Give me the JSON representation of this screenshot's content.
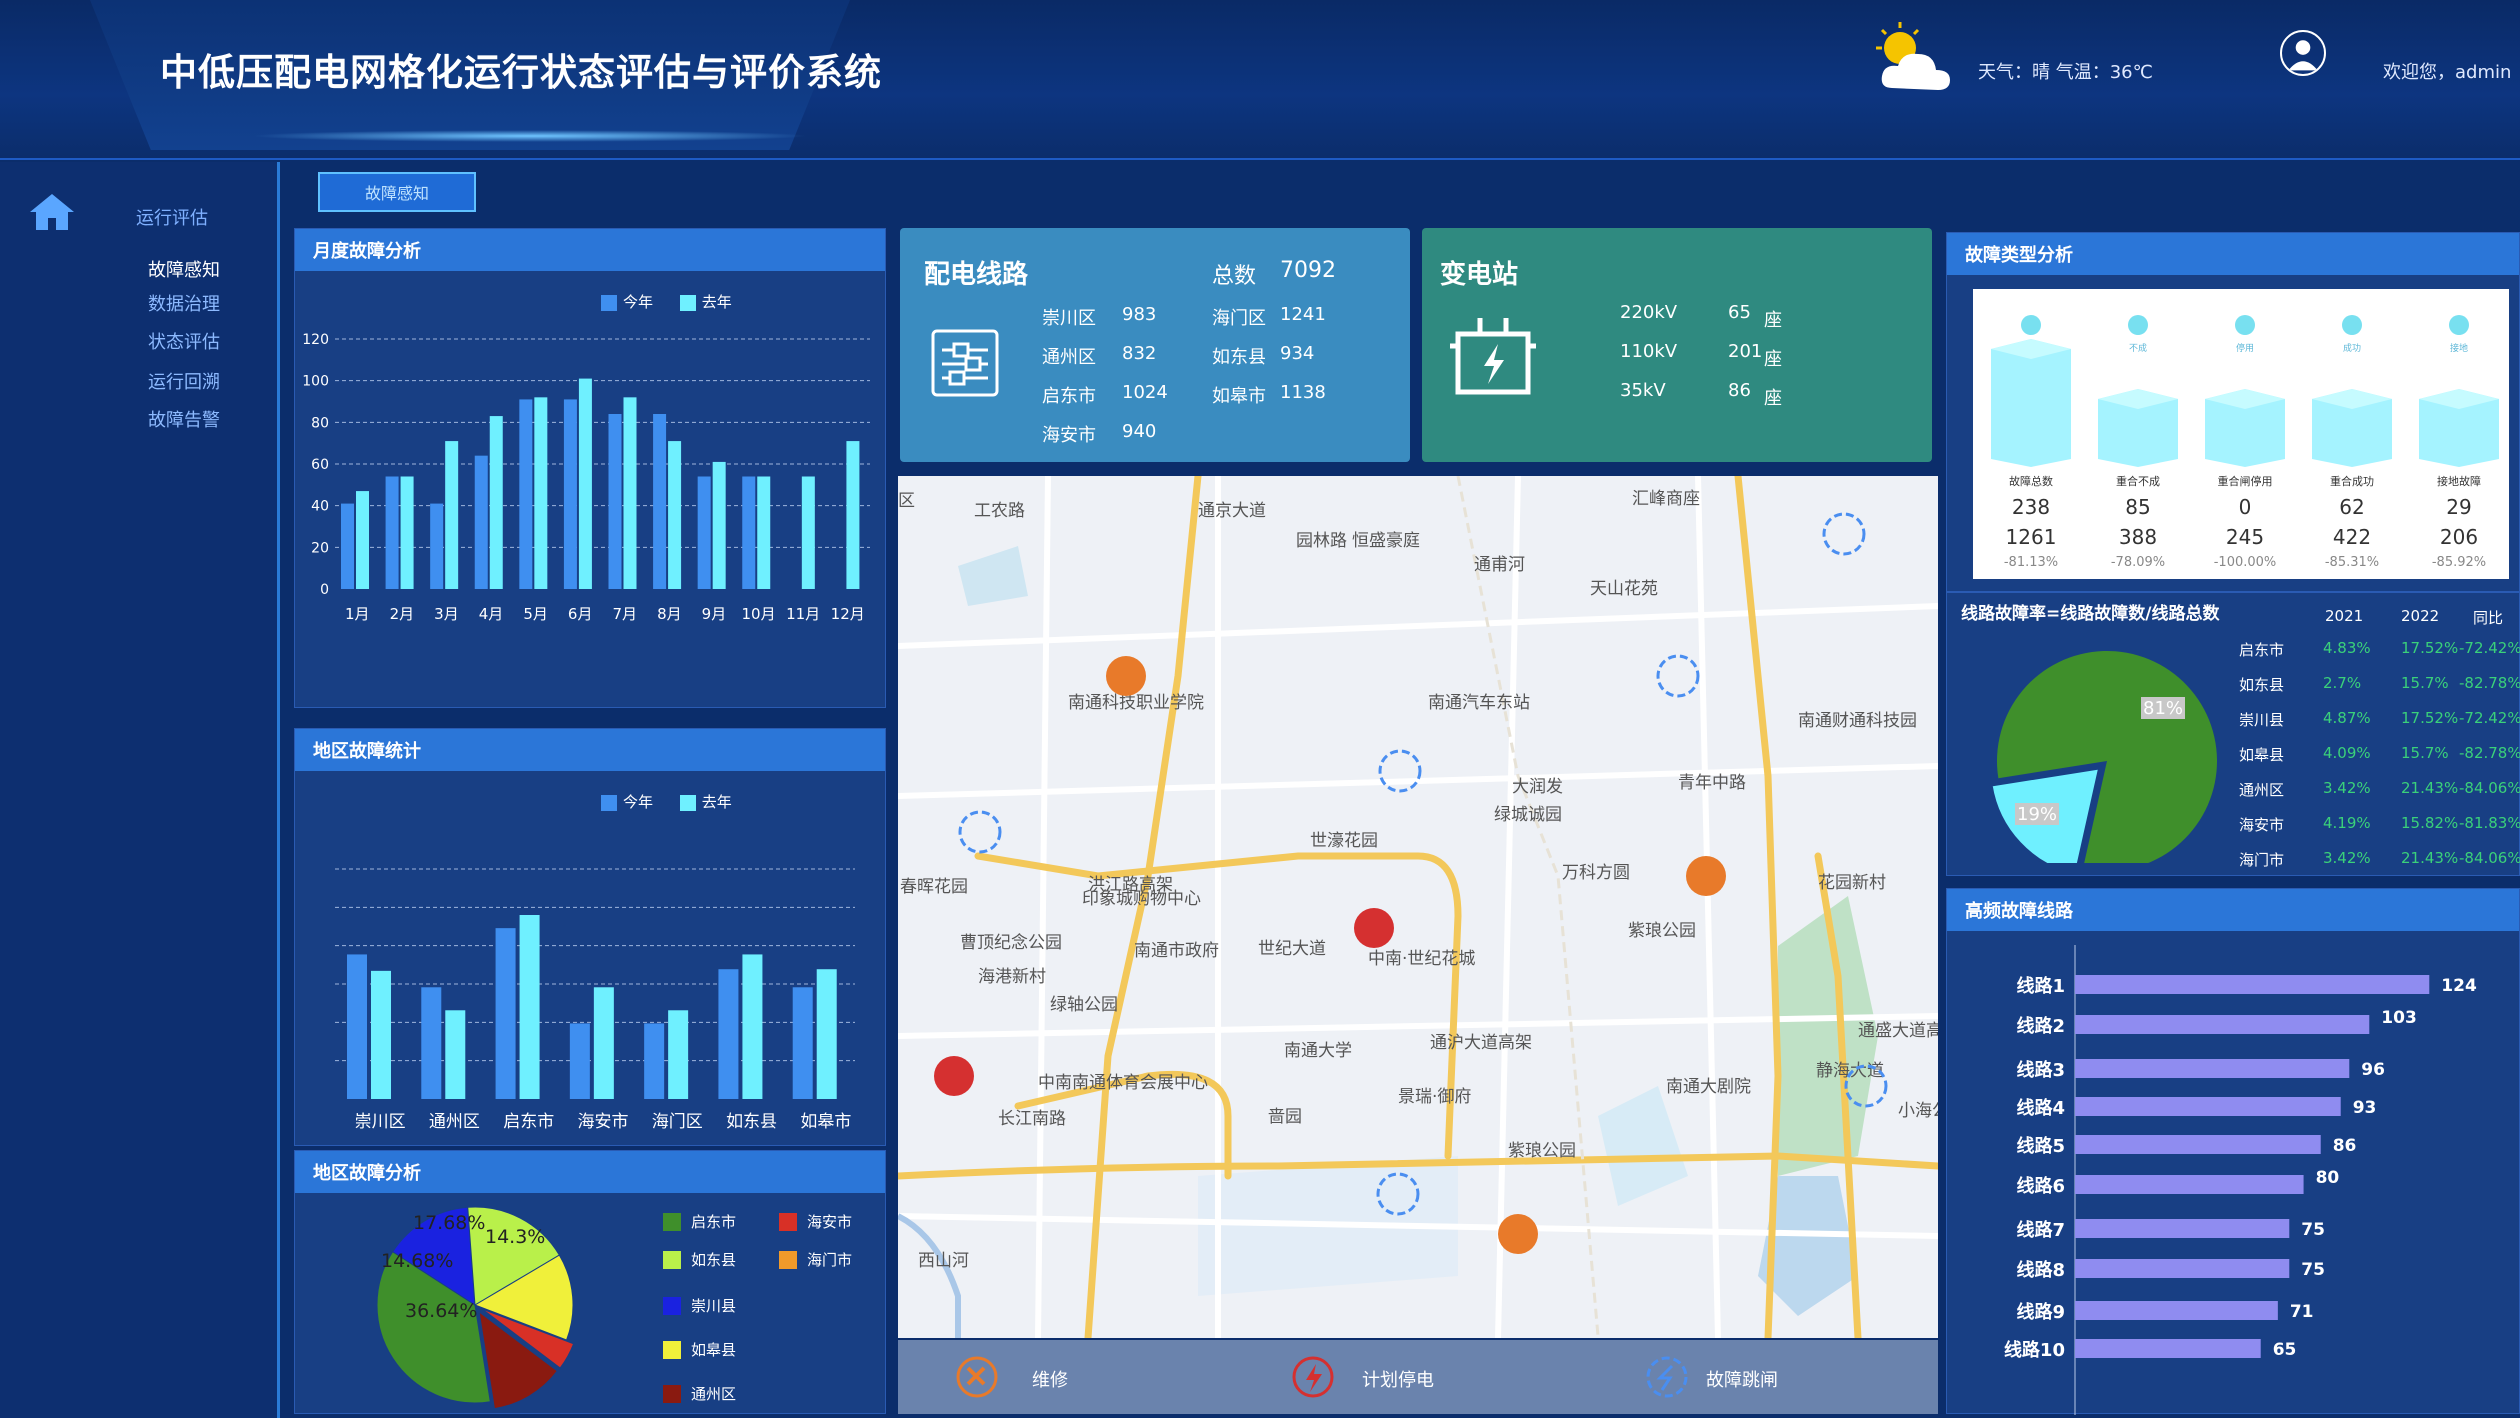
{
  "app": {
    "title": "中低压配电网格化运行状态评估与评价系统",
    "weather": "天气：晴  气温：36℃",
    "welcome": "欢迎您，admin"
  },
  "sidebar": {
    "head": "运行评估",
    "items": [
      {
        "label": "故障感知"
      },
      {
        "label": "数据治理"
      },
      {
        "label": "状态评估"
      },
      {
        "label": "运行回溯"
      },
      {
        "label": "故障告警"
      }
    ]
  },
  "tab": {
    "label": "故障感知"
  },
  "colors": {
    "this_year": "#3f8ff0",
    "last_year": "#6ff0ff",
    "pie_green": "#3f8f2b",
    "pie_cyan": "#6ff0ff",
    "bar_purple": "#8f8cf0"
  },
  "monthly": {
    "title": "月度故障分析",
    "legend": [
      "今年",
      "去年"
    ],
    "chart_data": {
      "type": "bar",
      "categories": [
        "1月",
        "2月",
        "3月",
        "4月",
        "5月",
        "6月",
        "7月",
        "8月",
        "9月",
        "10月",
        "11月",
        "12月"
      ],
      "series": [
        {
          "name": "今年",
          "values": [
            41,
            54,
            41,
            64,
            91,
            91,
            84,
            84,
            54,
            54,
            0,
            0
          ]
        },
        {
          "name": "去年",
          "values": [
            47,
            54,
            71,
            83,
            92,
            101,
            92,
            71,
            61,
            54,
            54,
            71
          ]
        }
      ],
      "yticks": [
        0,
        20,
        40,
        60,
        80,
        100,
        120
      ],
      "ylim": [
        0,
        120
      ]
    }
  },
  "region_stats": {
    "title": "地区故障统计",
    "legend": [
      "今年",
      "去年"
    ],
    "chart_data": {
      "type": "bar",
      "categories": [
        "崇川区",
        "通州区",
        "启东市",
        "海安市",
        "海门区",
        "如东县",
        "如皋市"
      ],
      "series": [
        {
          "name": "今年",
          "values": [
            88,
            68,
            104,
            46,
            46,
            79,
            68
          ]
        },
        {
          "name": "去年",
          "values": [
            78,
            54,
            112,
            68,
            54,
            88,
            79
          ]
        }
      ],
      "ylim": [
        0,
        140
      ]
    }
  },
  "region_pie": {
    "title": "地区故障分析",
    "chart_data": {
      "type": "pie",
      "slices": [
        {
          "name": "启东市",
          "value": 36.64,
          "color": "#3f8f2b"
        },
        {
          "name": "如东县",
          "value": 17.68,
          "color": "#b9f04a"
        },
        {
          "name": "如皋市",
          "value": 14.3,
          "color": "#f0f03a"
        },
        {
          "name": "海安市",
          "value": 4.5,
          "color": "#d83026"
        },
        {
          "name": "通州区",
          "value": 12.2,
          "color": "#8a1a10"
        },
        {
          "name": "崇川区",
          "value": 14.68,
          "color": "#1a22e0"
        }
      ]
    },
    "labels": [
      "17.68%",
      "14.3%",
      "14.68%",
      "36.64%"
    ],
    "legend": [
      {
        "name": "启东市",
        "color": "#3f8f2b"
      },
      {
        "name": "海安市",
        "color": "#d83026"
      },
      {
        "name": "如东县",
        "color": "#b9f04a"
      },
      {
        "name": "海门市",
        "color": "#f09a2a"
      },
      {
        "name": "崇川县",
        "color": "#1a22e0"
      },
      {
        "name": "如皋县",
        "color": "#f0f03a"
      },
      {
        "name": "通州区",
        "color": "#8a1a10"
      }
    ]
  },
  "lines_card": {
    "title": "配电线路",
    "total_label": "总数",
    "total": "7092",
    "rows": [
      [
        "崇川区",
        "983",
        "海门区",
        "1241"
      ],
      [
        "通州区",
        "832",
        "如东县",
        "934"
      ],
      [
        "启东市",
        "1024",
        "如皋市",
        "1138"
      ],
      [
        "海安市",
        "940",
        "",
        ""
      ]
    ]
  },
  "substation_card": {
    "title": "变电站",
    "rows": [
      [
        "220kV",
        "65",
        "座"
      ],
      [
        "110kV",
        "201",
        "座"
      ],
      [
        "35kV",
        "86",
        "座"
      ]
    ]
  },
  "fault_types": {
    "title": "故障类型分析",
    "cols": [
      {
        "small": "故障总数",
        "v1": "238",
        "v2": "1261",
        "pct": "-81.13%",
        "icon": "故障"
      },
      {
        "small": "重合不成",
        "v1": "85",
        "v2": "388",
        "pct": "-78.09%",
        "icon": "不成"
      },
      {
        "small": "重合闸停用",
        "v1": "0",
        "v2": "245",
        "pct": "-100.00%",
        "icon": "停用"
      },
      {
        "small": "重合成功",
        "v1": "62",
        "v2": "422",
        "pct": "-85.31%",
        "icon": "成功"
      },
      {
        "small": "接地故障",
        "v1": "29",
        "v2": "206",
        "pct": "-85.92%",
        "icon": "接地"
      }
    ]
  },
  "line_rate": {
    "title": "线路故障率=线路故障数/线路总数",
    "headers": [
      "2021",
      "2022",
      "同比"
    ],
    "chart_data": {
      "type": "pie",
      "slices": [
        {
          "name": "81%",
          "value": 81
        },
        {
          "name": "19%",
          "value": 19
        }
      ]
    },
    "rows": [
      [
        "启东市",
        "4.83%",
        "17.52%",
        "-72.42%"
      ],
      [
        "如东县",
        "2.7%",
        "15.7%",
        "-82.78%"
      ],
      [
        "崇川县",
        "4.87%",
        "17.52%",
        "-72.42%"
      ],
      [
        "如皋县",
        "4.09%",
        "15.7%",
        "-82.78%"
      ],
      [
        "通州区",
        "3.42%",
        "21.43%",
        "-84.06%"
      ],
      [
        "海安市",
        "4.19%",
        "15.82%",
        "-81.83%"
      ],
      [
        "海门市",
        "3.42%",
        "21.43%",
        "-84.06%"
      ]
    ]
  },
  "freq_lines": {
    "title": "高频故障线路",
    "chart_data": {
      "type": "bar",
      "orientation": "horizontal",
      "categories": [
        "线路1",
        "线路2",
        "线路3",
        "线路4",
        "线路5",
        "线路6",
        "线路7",
        "线路8",
        "线路9",
        "线路10"
      ],
      "values": [
        124,
        103,
        96,
        93,
        86,
        80,
        75,
        75,
        71,
        65
      ],
      "xlim": [
        0,
        140
      ]
    }
  },
  "map": {
    "labels": [
      "工农路",
      "通京大道",
      "恒盛豪庭",
      "汇峰商座",
      "通甫河",
      "天山花苑",
      "园林路",
      "南通汽车东站",
      "南通科技职业学院",
      "大润发",
      "青年中路",
      "南通财通科技园",
      "洪江路高架",
      "世濠花园",
      "绿城诚园",
      "春晖花园",
      "印象城购物中心",
      "万科方圆",
      "花园新村",
      "曹顶纪念公园",
      "南通市政府",
      "世纪大道",
      "紫琅公园",
      "中南·世纪花城",
      "海港新村",
      "绿轴公园",
      "南通大学",
      "通沪大道高架",
      "静海大道",
      "通盛大道高架",
      "中南南通体育会展中心",
      "景瑞·御府",
      "南通大剧院",
      "啬园",
      "长江南路",
      "紫琅公园",
      "小海公",
      "区",
      "西山河"
    ],
    "legend": [
      {
        "label": "维修"
      },
      {
        "label": "计划停电"
      },
      {
        "label": "故障跳闸"
      }
    ]
  }
}
